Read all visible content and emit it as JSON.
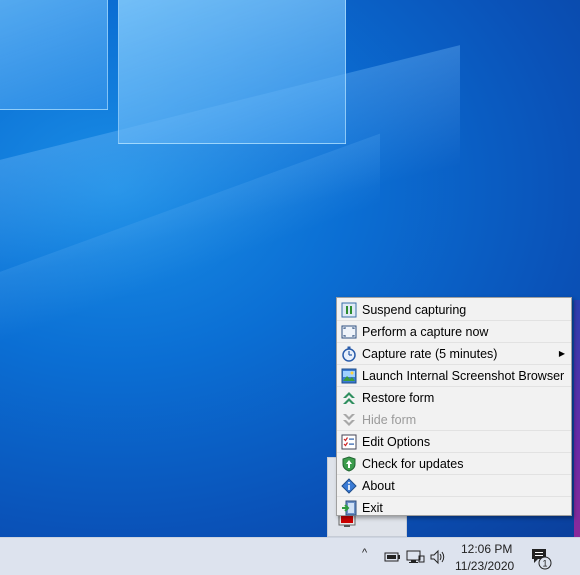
{
  "menu": {
    "items": [
      {
        "label": "Suspend capturing",
        "icon": "pause-icon",
        "enabled": true
      },
      {
        "label": "Perform a capture now",
        "icon": "capture-frame-icon",
        "enabled": true
      },
      {
        "label": "Capture rate (5 minutes)",
        "icon": "stopwatch-icon",
        "enabled": true,
        "submenu": true
      },
      {
        "label": "Launch Internal Screenshot Browser",
        "icon": "screenshot-browser-icon",
        "enabled": true
      },
      {
        "label": "Restore form",
        "icon": "restore-up-icon",
        "enabled": true
      },
      {
        "label": "Hide form",
        "icon": "hide-down-icon",
        "enabled": false
      },
      {
        "label": "Edit Options",
        "icon": "options-list-icon",
        "enabled": true
      },
      {
        "label": "Check for updates",
        "icon": "update-shield-icon",
        "enabled": true
      },
      {
        "label": "About",
        "icon": "info-icon",
        "enabled": true
      },
      {
        "label": "Exit",
        "icon": "exit-icon",
        "enabled": true
      }
    ],
    "submenu_arrow": "▶"
  },
  "taskbar": {
    "time": "12:06 PM",
    "date": "11/23/2020",
    "chevron": "^",
    "notification_count": "1"
  },
  "colors": {
    "desktop_blue": "#0b6fd4",
    "menu_bg": "#f2f2f2",
    "taskbar_bg": "#dde3ee"
  }
}
